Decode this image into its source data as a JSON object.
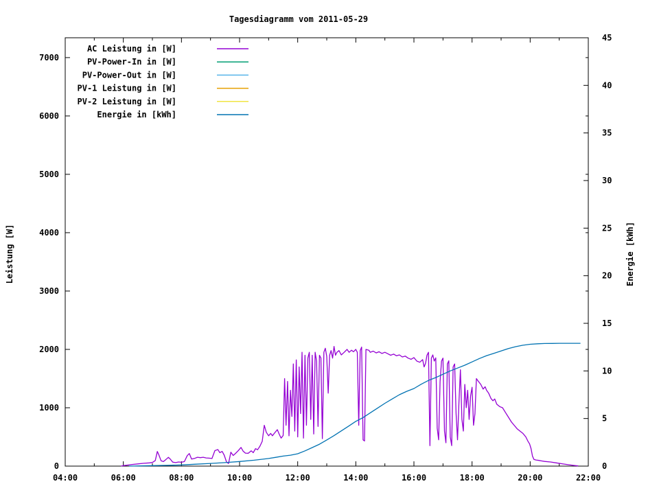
{
  "title": "Tagesdiagramm vom 2011-05-29",
  "axes": {
    "left": {
      "label": "Leistung [W]",
      "tick_labels": [
        "0",
        "1000",
        "2000",
        "3000",
        "4000",
        "5000",
        "6000",
        "7000"
      ],
      "tick_values": [
        0,
        1000,
        2000,
        3000,
        4000,
        5000,
        6000,
        7000
      ],
      "range": [
        0,
        7340
      ]
    },
    "right": {
      "label": "Energie [kWh]",
      "tick_labels": [
        "0",
        "5",
        "10",
        "15",
        "20",
        "25",
        "30",
        "35",
        "40",
        "45"
      ],
      "tick_values": [
        0,
        5,
        10,
        15,
        20,
        25,
        30,
        35,
        40,
        45
      ],
      "range": [
        0,
        45
      ]
    },
    "x": {
      "ticks": [
        {
          "hour": 4,
          "label": "04:00"
        },
        {
          "hour": 6,
          "label": "06:00"
        },
        {
          "hour": 8,
          "label": "08:00"
        },
        {
          "hour": 10,
          "label": "10:00"
        },
        {
          "hour": 12,
          "label": "12:00"
        },
        {
          "hour": 14,
          "label": "14:00"
        },
        {
          "hour": 16,
          "label": "16:00"
        },
        {
          "hour": 18,
          "label": "18:00"
        },
        {
          "hour": 20,
          "label": "20:00"
        },
        {
          "hour": 22,
          "label": "22:00"
        }
      ],
      "minor_every_hours": 1,
      "range_hours": [
        4,
        22
      ]
    }
  },
  "legend": [
    {
      "label": "AC Leistung in [W]",
      "color": "#9400d3"
    },
    {
      "label": "PV-Power-In in [W]",
      "color": "#009e73"
    },
    {
      "label": "PV-Power-Out in [W]",
      "color": "#56b4e9"
    },
    {
      "label": "PV-1 Leistung in [W]",
      "color": "#e69f00"
    },
    {
      "label": "PV-2 Leistung in [W]",
      "color": "#f0e442"
    },
    {
      "label": "Energie in [kWh]",
      "color": "#0072b2"
    }
  ],
  "chart_data": {
    "type": "line",
    "title": "Tagesdiagramm vom 2011-05-29",
    "xlabel": "",
    "ylabel_left": "Leistung [W]",
    "ylabel_right": "Energie [kWh]",
    "xlim_hours": [
      4,
      22
    ],
    "ylim_left": [
      0,
      7340
    ],
    "ylim_right": [
      0,
      45
    ],
    "grid": false,
    "legend_position": "top-left-inside",
    "series": [
      {
        "name": "AC Leistung in [W]",
        "color": "#9400d3",
        "axis": "left",
        "unit": "W",
        "points": [
          [
            5.92,
            0
          ],
          [
            6.0,
            8
          ],
          [
            6.15,
            18
          ],
          [
            6.3,
            28
          ],
          [
            6.5,
            38
          ],
          [
            6.7,
            48
          ],
          [
            6.9,
            55
          ],
          [
            7.0,
            62
          ],
          [
            7.1,
            95
          ],
          [
            7.17,
            250
          ],
          [
            7.22,
            195
          ],
          [
            7.3,
            90
          ],
          [
            7.38,
            78
          ],
          [
            7.47,
            115
          ],
          [
            7.55,
            150
          ],
          [
            7.62,
            118
          ],
          [
            7.7,
            68
          ],
          [
            7.8,
            60
          ],
          [
            7.9,
            70
          ],
          [
            8.0,
            66
          ],
          [
            8.1,
            78
          ],
          [
            8.2,
            180
          ],
          [
            8.27,
            215
          ],
          [
            8.35,
            120
          ],
          [
            8.45,
            132
          ],
          [
            8.55,
            152
          ],
          [
            8.65,
            145
          ],
          [
            8.75,
            152
          ],
          [
            8.85,
            140
          ],
          [
            8.95,
            136
          ],
          [
            9.05,
            130
          ],
          [
            9.15,
            265
          ],
          [
            9.25,
            285
          ],
          [
            9.32,
            230
          ],
          [
            9.4,
            252
          ],
          [
            9.47,
            188
          ],
          [
            9.55,
            70
          ],
          [
            9.62,
            45
          ],
          [
            9.7,
            238
          ],
          [
            9.78,
            182
          ],
          [
            9.85,
            212
          ],
          [
            9.95,
            262
          ],
          [
            10.05,
            320
          ],
          [
            10.12,
            258
          ],
          [
            10.2,
            222
          ],
          [
            10.3,
            220
          ],
          [
            10.4,
            262
          ],
          [
            10.47,
            230
          ],
          [
            10.55,
            300
          ],
          [
            10.62,
            280
          ],
          [
            10.7,
            340
          ],
          [
            10.78,
            425
          ],
          [
            10.85,
            700
          ],
          [
            10.92,
            580
          ],
          [
            11.0,
            520
          ],
          [
            11.07,
            560
          ],
          [
            11.13,
            520
          ],
          [
            11.2,
            565
          ],
          [
            11.3,
            625
          ],
          [
            11.37,
            540
          ],
          [
            11.43,
            480
          ],
          [
            11.5,
            525
          ],
          [
            11.55,
            1500
          ],
          [
            11.6,
            700
          ],
          [
            11.65,
            1450
          ],
          [
            11.7,
            520
          ],
          [
            11.75,
            1300
          ],
          [
            11.8,
            850
          ],
          [
            11.85,
            1750
          ],
          [
            11.9,
            600
          ],
          [
            11.95,
            1820
          ],
          [
            12.0,
            500
          ],
          [
            12.05,
            1700
          ],
          [
            12.1,
            900
          ],
          [
            12.15,
            1950
          ],
          [
            12.2,
            480
          ],
          [
            12.25,
            1900
          ],
          [
            12.3,
            700
          ],
          [
            12.35,
            1850
          ],
          [
            12.4,
            1950
          ],
          [
            12.45,
            800
          ],
          [
            12.5,
            1900
          ],
          [
            12.55,
            550
          ],
          [
            12.6,
            1950
          ],
          [
            12.65,
            1800
          ],
          [
            12.7,
            680
          ],
          [
            12.75,
            1900
          ],
          [
            12.8,
            1850
          ],
          [
            12.85,
            470
          ],
          [
            12.9,
            1950
          ],
          [
            12.95,
            2020
          ],
          [
            13.0,
            1880
          ],
          [
            13.05,
            1250
          ],
          [
            13.1,
            1900
          ],
          [
            13.15,
            1980
          ],
          [
            13.2,
            1850
          ],
          [
            13.25,
            2050
          ],
          [
            13.3,
            1900
          ],
          [
            13.35,
            1950
          ],
          [
            13.42,
            1980
          ],
          [
            13.5,
            1905
          ],
          [
            13.6,
            1950
          ],
          [
            13.7,
            2000
          ],
          [
            13.77,
            1950
          ],
          [
            13.85,
            1985
          ],
          [
            13.92,
            1960
          ],
          [
            14.0,
            2000
          ],
          [
            14.05,
            1950
          ],
          [
            14.1,
            700
          ],
          [
            14.15,
            1980
          ],
          [
            14.2,
            2040
          ],
          [
            14.25,
            450
          ],
          [
            14.3,
            430
          ],
          [
            14.35,
            2000
          ],
          [
            14.45,
            1985
          ],
          [
            14.5,
            1950
          ],
          [
            14.6,
            1970
          ],
          [
            14.7,
            1940
          ],
          [
            14.8,
            1960
          ],
          [
            14.9,
            1930
          ],
          [
            15.0,
            1950
          ],
          [
            15.1,
            1925
          ],
          [
            15.2,
            1900
          ],
          [
            15.3,
            1920
          ],
          [
            15.4,
            1890
          ],
          [
            15.5,
            1905
          ],
          [
            15.6,
            1870
          ],
          [
            15.7,
            1885
          ],
          [
            15.8,
            1850
          ],
          [
            15.9,
            1830
          ],
          [
            16.0,
            1860
          ],
          [
            16.1,
            1800
          ],
          [
            16.2,
            1780
          ],
          [
            16.3,
            1825
          ],
          [
            16.35,
            1700
          ],
          [
            16.4,
            1760
          ],
          [
            16.45,
            1900
          ],
          [
            16.5,
            1950
          ],
          [
            16.55,
            350
          ],
          [
            16.6,
            1850
          ],
          [
            16.65,
            1905
          ],
          [
            16.7,
            1800
          ],
          [
            16.75,
            1855
          ],
          [
            16.8,
            650
          ],
          [
            16.85,
            450
          ],
          [
            16.9,
            1450
          ],
          [
            16.95,
            1800
          ],
          [
            17.0,
            1850
          ],
          [
            17.05,
            600
          ],
          [
            17.1,
            400
          ],
          [
            17.15,
            1750
          ],
          [
            17.2,
            1805
          ],
          [
            17.25,
            500
          ],
          [
            17.3,
            350
          ],
          [
            17.35,
            1700
          ],
          [
            17.4,
            1750
          ],
          [
            17.45,
            900
          ],
          [
            17.5,
            450
          ],
          [
            17.55,
            1100
          ],
          [
            17.6,
            1650
          ],
          [
            17.65,
            800
          ],
          [
            17.7,
            600
          ],
          [
            17.75,
            1400
          ],
          [
            17.8,
            1000
          ],
          [
            17.85,
            1300
          ],
          [
            17.9,
            800
          ],
          [
            17.95,
            1200
          ],
          [
            18.0,
            1350
          ],
          [
            18.05,
            700
          ],
          [
            18.1,
            900
          ],
          [
            18.15,
            1500
          ],
          [
            18.22,
            1450
          ],
          [
            18.3,
            1400
          ],
          [
            18.38,
            1320
          ],
          [
            18.45,
            1360
          ],
          [
            18.5,
            1300
          ],
          [
            18.57,
            1250
          ],
          [
            18.65,
            1160
          ],
          [
            18.72,
            1120
          ],
          [
            18.78,
            1150
          ],
          [
            18.85,
            1060
          ],
          [
            18.95,
            1020
          ],
          [
            19.05,
            1000
          ],
          [
            19.15,
            920
          ],
          [
            19.25,
            840
          ],
          [
            19.35,
            760
          ],
          [
            19.45,
            700
          ],
          [
            19.55,
            640
          ],
          [
            19.65,
            600
          ],
          [
            19.75,
            560
          ],
          [
            19.85,
            500
          ],
          [
            19.92,
            430
          ],
          [
            19.98,
            380
          ],
          [
            20.03,
            300
          ],
          [
            20.08,
            170
          ],
          [
            20.13,
            115
          ],
          [
            20.2,
            105
          ],
          [
            20.3,
            98
          ],
          [
            20.4,
            88
          ],
          [
            20.5,
            80
          ],
          [
            20.7,
            70
          ],
          [
            20.9,
            55
          ],
          [
            21.1,
            40
          ],
          [
            21.3,
            25
          ],
          [
            21.5,
            12
          ],
          [
            21.65,
            4
          ]
        ]
      },
      {
        "name": "PV-Power-In in [W]",
        "color": "#009e73",
        "axis": "left",
        "unit": "W",
        "points": []
      },
      {
        "name": "PV-Power-Out in [W]",
        "color": "#56b4e9",
        "axis": "left",
        "unit": "W",
        "points": []
      },
      {
        "name": "PV-1 Leistung in [W]",
        "color": "#e69f00",
        "axis": "left",
        "unit": "W",
        "points": []
      },
      {
        "name": "PV-2 Leistung in [W]",
        "color": "#f0e442",
        "axis": "left",
        "unit": "W",
        "points": []
      },
      {
        "name": "Energie in [kWh]",
        "color": "#0072b2",
        "axis": "right",
        "unit": "kWh",
        "points": [
          [
            6.2,
            0
          ],
          [
            7.0,
            0.05
          ],
          [
            7.5,
            0.08
          ],
          [
            8.0,
            0.12
          ],
          [
            8.5,
            0.2
          ],
          [
            9.0,
            0.28
          ],
          [
            9.5,
            0.37
          ],
          [
            10.0,
            0.48
          ],
          [
            10.5,
            0.62
          ],
          [
            11.0,
            0.8
          ],
          [
            11.25,
            0.92
          ],
          [
            11.5,
            1.05
          ],
          [
            11.75,
            1.15
          ],
          [
            12.0,
            1.3
          ],
          [
            12.25,
            1.6
          ],
          [
            12.5,
            1.95
          ],
          [
            12.75,
            2.3
          ],
          [
            13.0,
            2.75
          ],
          [
            13.25,
            3.2
          ],
          [
            13.5,
            3.7
          ],
          [
            13.75,
            4.2
          ],
          [
            14.0,
            4.7
          ],
          [
            14.25,
            5.1
          ],
          [
            14.5,
            5.6
          ],
          [
            14.75,
            6.1
          ],
          [
            15.0,
            6.6
          ],
          [
            15.25,
            7.05
          ],
          [
            15.5,
            7.5
          ],
          [
            15.75,
            7.85
          ],
          [
            16.0,
            8.15
          ],
          [
            16.25,
            8.6
          ],
          [
            16.5,
            9.0
          ],
          [
            16.75,
            9.3
          ],
          [
            17.0,
            9.65
          ],
          [
            17.25,
            10.0
          ],
          [
            17.5,
            10.3
          ],
          [
            17.75,
            10.6
          ],
          [
            18.0,
            10.95
          ],
          [
            18.25,
            11.3
          ],
          [
            18.5,
            11.6
          ],
          [
            18.75,
            11.85
          ],
          [
            19.0,
            12.1
          ],
          [
            19.25,
            12.35
          ],
          [
            19.5,
            12.55
          ],
          [
            19.75,
            12.7
          ],
          [
            20.0,
            12.8
          ],
          [
            20.25,
            12.85
          ],
          [
            20.5,
            12.88
          ],
          [
            20.75,
            12.89
          ],
          [
            21.0,
            12.9
          ],
          [
            21.25,
            12.9
          ],
          [
            21.5,
            12.9
          ],
          [
            21.73,
            12.9
          ]
        ]
      }
    ]
  }
}
